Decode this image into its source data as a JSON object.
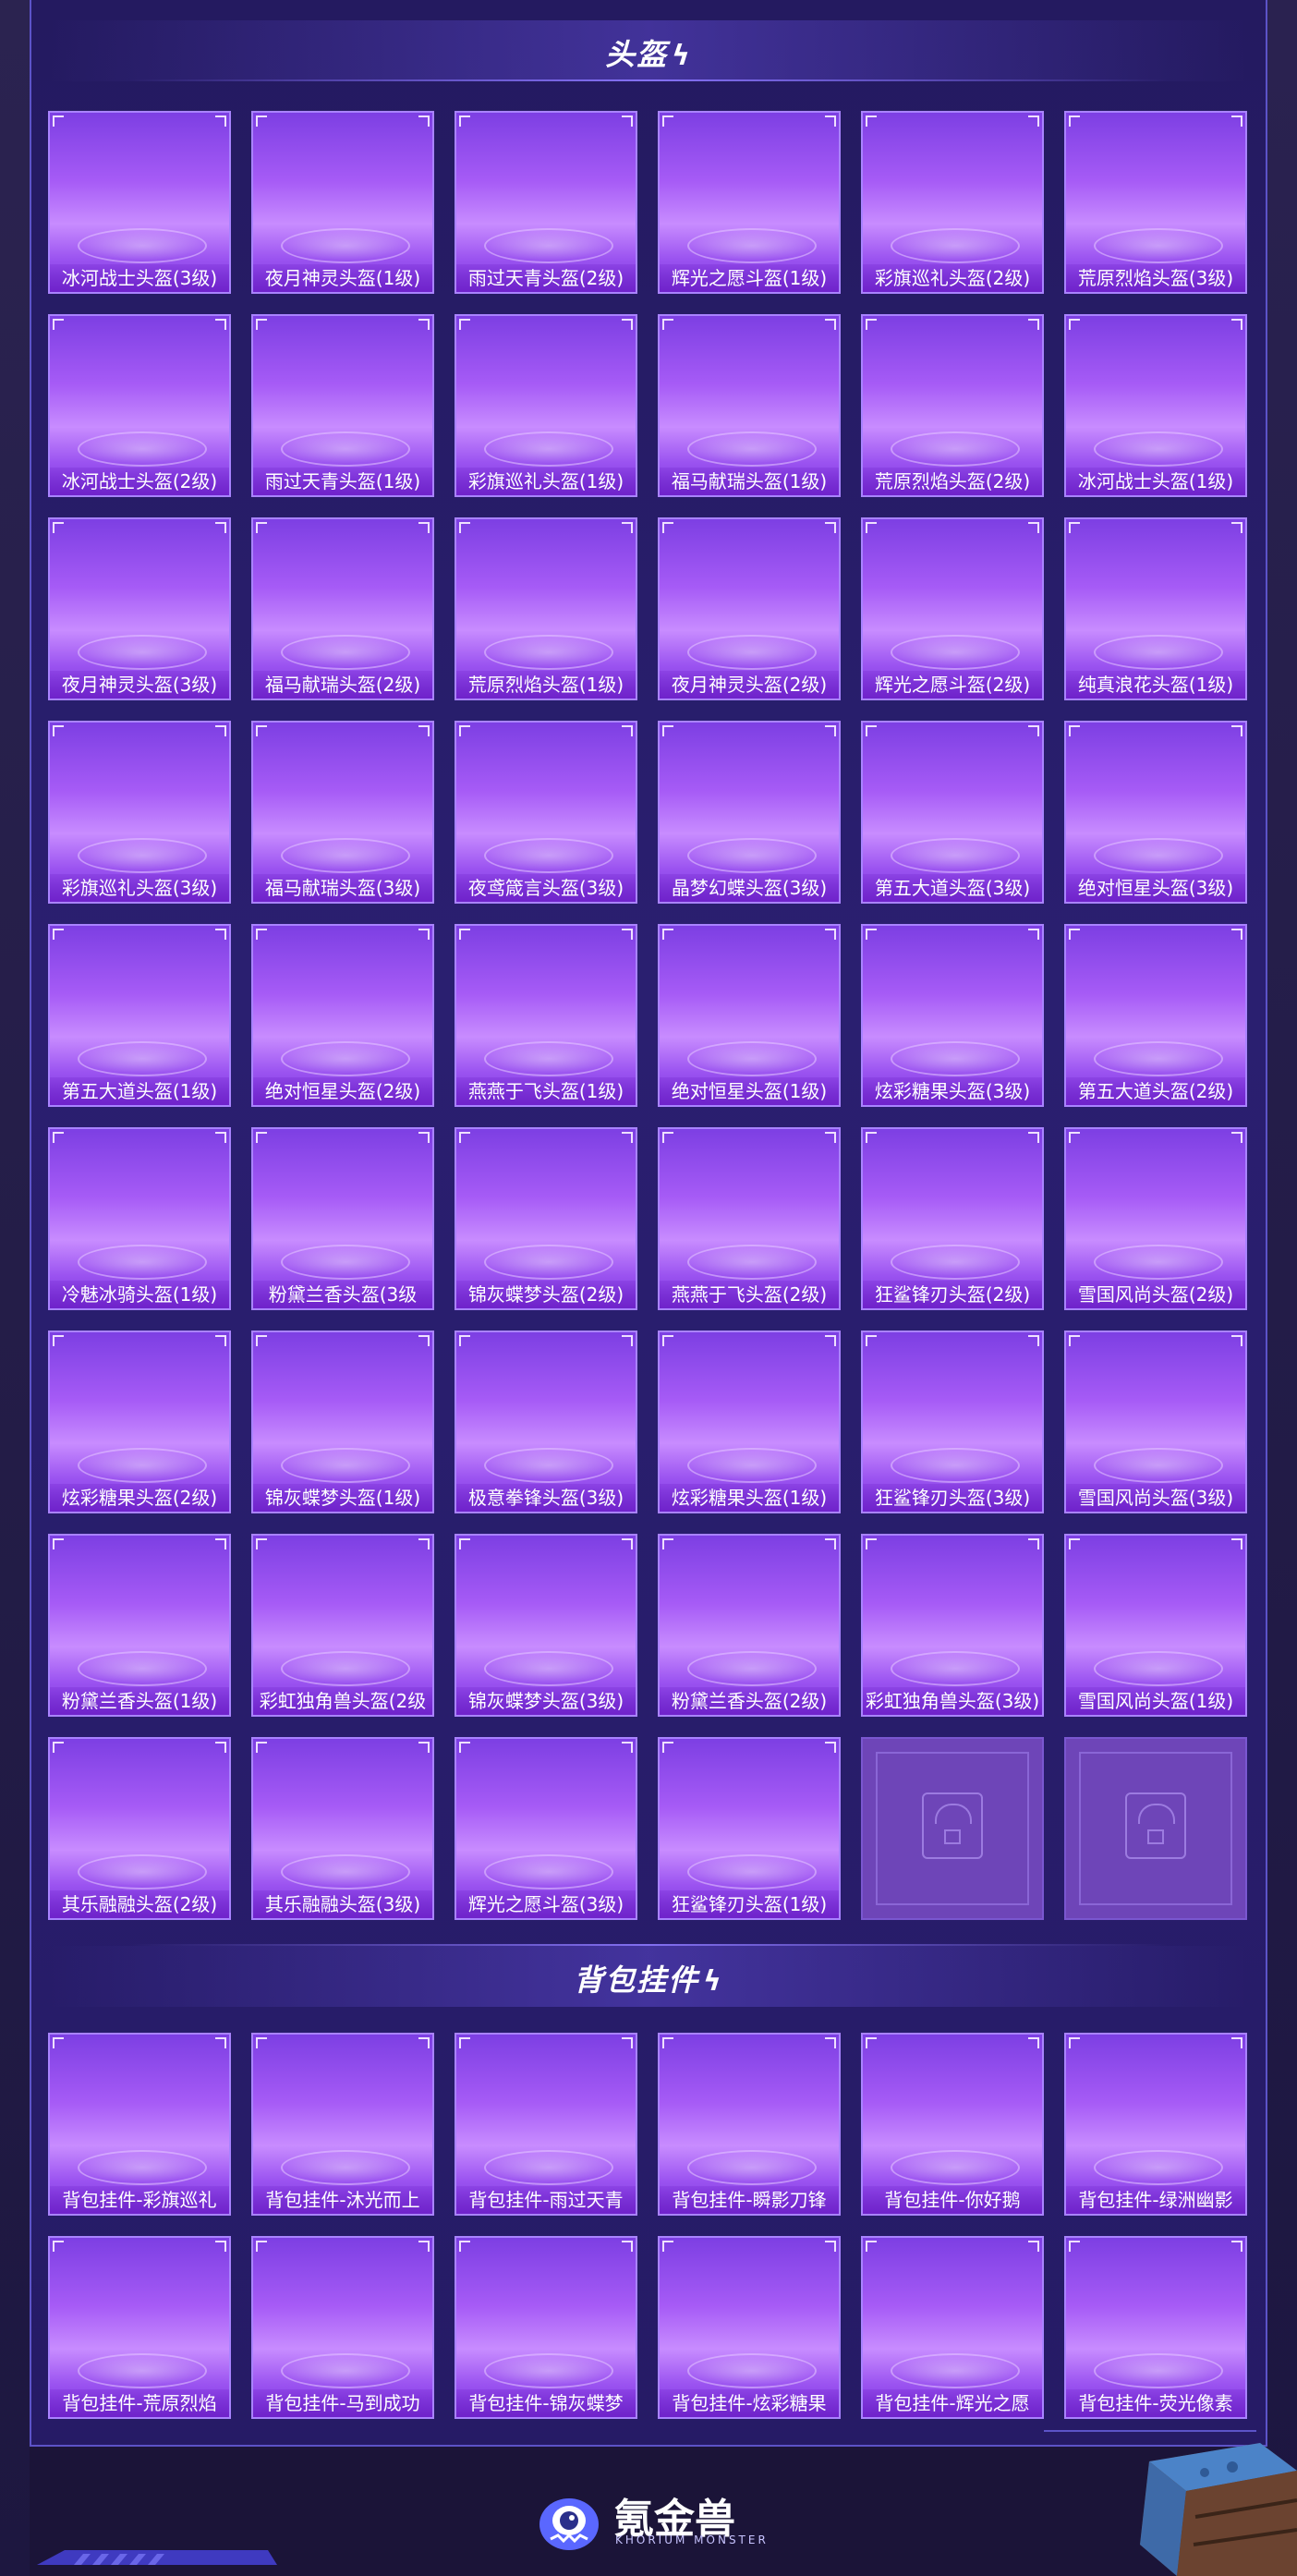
{
  "sections": {
    "helmets": {
      "title": "头盔",
      "items": [
        "冰河战士头盔(3级)",
        "夜月神灵头盔(1级)",
        "雨过天青头盔(2级)",
        "辉光之愿斗盔(1级)",
        "彩旗巡礼头盔(2级)",
        "荒原烈焰头盔(3级)",
        "冰河战士头盔(2级)",
        "雨过天青头盔(1级)",
        "彩旗巡礼头盔(1级)",
        "福马献瑞头盔(1级)",
        "荒原烈焰头盔(2级)",
        "冰河战士头盔(1级)",
        "夜月神灵头盔(3级)",
        "福马献瑞头盔(2级)",
        "荒原烈焰头盔(1级)",
        "夜月神灵头盔(2级)",
        "辉光之愿斗盔(2级)",
        "纯真浪花头盔(1级)",
        "彩旗巡礼头盔(3级)",
        "福马献瑞头盔(3级)",
        "夜鸢箴言头盔(3级)",
        "晶梦幻蝶头盔(3级)",
        "第五大道头盔(3级)",
        "绝对恒星头盔(3级)",
        "第五大道头盔(1级)",
        "绝对恒星头盔(2级)",
        "燕燕于飞头盔(1级)",
        "绝对恒星头盔(1级)",
        "炫彩糖果头盔(3级)",
        "第五大道头盔(2级)",
        "冷魅冰骑头盔(1级)",
        "粉黛兰香头盔(3级",
        "锦灰蝶梦头盔(2级)",
        "燕燕于飞头盔(2级)",
        "狂鲨锋刃头盔(2级)",
        "雪国风尚头盔(2级)",
        "炫彩糖果头盔(2级)",
        "锦灰蝶梦头盔(1级)",
        "极意拳锋头盔(3级)",
        "炫彩糖果头盔(1级)",
        "狂鲨锋刃头盔(3级)",
        "雪国风尚头盔(3级)",
        "粉黛兰香头盔(1级)",
        "彩虹独角兽头盔(2级",
        "锦灰蝶梦头盔(3级)",
        "粉黛兰香头盔(2级)",
        "彩虹独角兽头盔(3级)",
        "雪国风尚头盔(1级)",
        "其乐融融头盔(2级)",
        "其乐融融头盔(3级)",
        "辉光之愿斗盔(3级)",
        "狂鲨锋刃头盔(1级)",
        "",
        ""
      ]
    },
    "pendants": {
      "title": "背包挂件",
      "items": [
        "背包挂件-彩旗巡礼",
        "背包挂件-沐光而上",
        "背包挂件-雨过天青",
        "背包挂件-瞬影刀锋",
        "背包挂件-你好鹅",
        "背包挂件-绿洲幽影",
        "背包挂件-荒原烈焰",
        "背包挂件-马到成功",
        "背包挂件-锦灰蝶梦",
        "背包挂件-炫彩糖果",
        "背包挂件-辉光之愿",
        "背包挂件-荧光像素"
      ]
    }
  },
  "footer": {
    "brand": "氪金兽",
    "brand_en": "KHORIUM MONSTER"
  },
  "colors": {
    "background": "#1b1438",
    "panel": "#261b66",
    "tile_purple": "#a65bf6",
    "border": "#a983ff"
  }
}
